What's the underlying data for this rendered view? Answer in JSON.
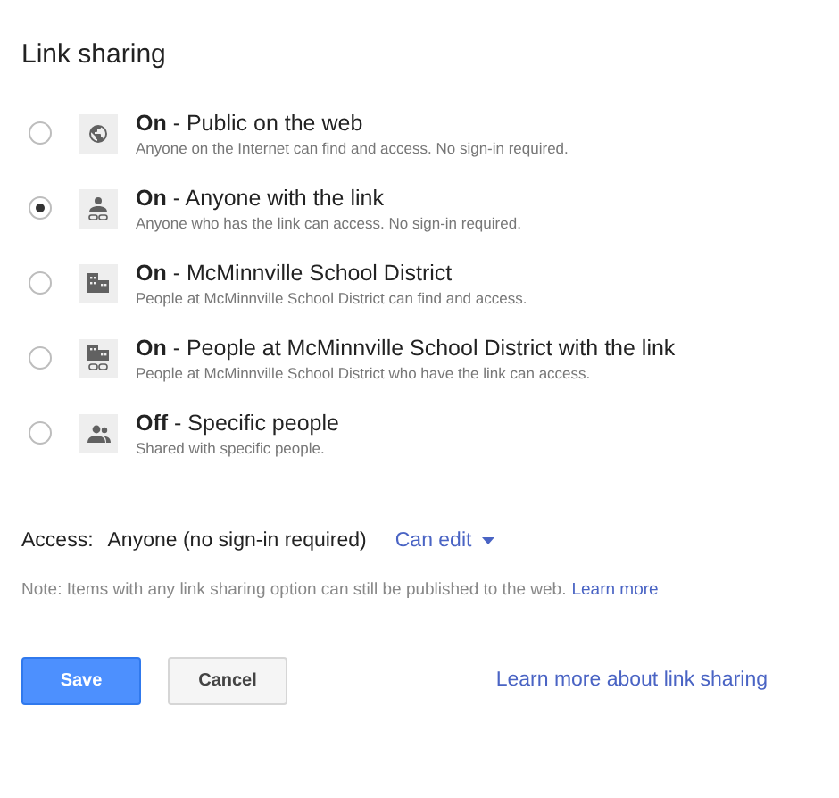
{
  "heading": "Link sharing",
  "options": [
    {
      "kind": "public",
      "title": "**On** - Public on the web",
      "description": "Anyone on the Internet can find and access. No sign-in required.",
      "selected": false
    },
    {
      "kind": "link",
      "title": "**On** - Anyone with the link",
      "description": "Anyone who has the link can access. No sign-in required.",
      "selected": true
    },
    {
      "kind": "domain",
      "title": "**On** - McMinnville School District",
      "description": "People at McMinnville School District can find and access.",
      "selected": false
    },
    {
      "kind": "domain-link",
      "title": "**On** - People at McMinnville School District with the link",
      "description": "People at McMinnville School District who have the link can access.",
      "selected": false
    },
    {
      "kind": "private",
      "title": "**Off** - Specific people",
      "description": "Shared with specific people.",
      "selected": false
    }
  ],
  "access": {
    "label": "Access:",
    "value": "Anyone (no sign-in required)",
    "permission": "Can edit"
  },
  "note": {
    "text": "Note: Items with any link sharing option can still be published to the web.",
    "link": "Learn more"
  },
  "buttons": {
    "save": "Save",
    "cancel": "Cancel"
  },
  "footer_link": "Learn more about link sharing"
}
